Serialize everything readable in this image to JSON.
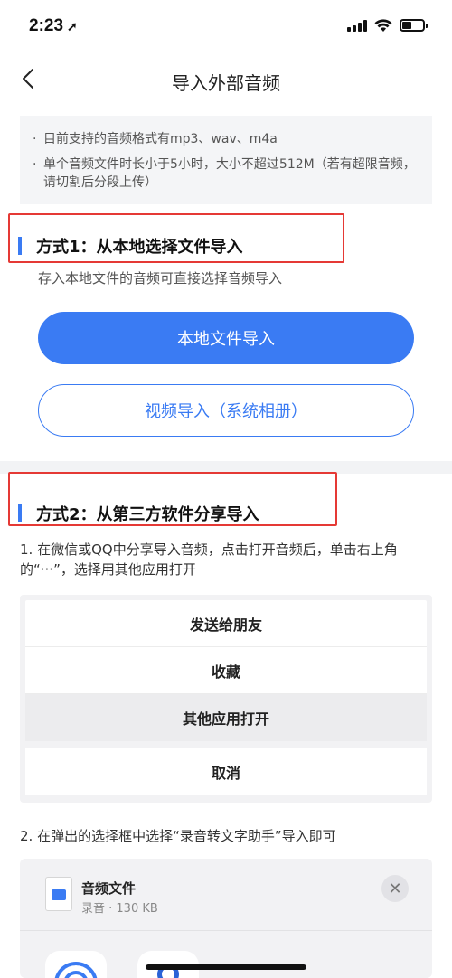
{
  "status_bar": {
    "time": "2:23",
    "location_glyph": "➚"
  },
  "nav": {
    "title": "导入外部音频",
    "back_icon": "chevron-left-icon"
  },
  "notice": {
    "bullet": "·",
    "items": [
      "目前支持的音频格式有mp3、wav、m4a",
      "单个音频文件时长小于5小时，大小不超过512M（若有超限音频，请切割后分段上传）"
    ]
  },
  "method1": {
    "heading": "方式1：从本地选择文件导入",
    "description": "存入本地文件的音频可直接选择音频导入",
    "primary_button": "本地文件导入",
    "secondary_button": "视频导入（系统相册）"
  },
  "method2": {
    "heading": "方式2：从第三方软件分享导入",
    "step1": "1. 在微信或QQ中分享导入音频，点击打开音频后，单击右上角的“···”，选择用其他应用打开",
    "sheet": {
      "items": [
        "发送给朋友",
        "收藏",
        "其他应用打开"
      ],
      "cancel": "取消"
    },
    "step2": "2. 在弹出的选择框中选择“录音转文字助手”导入即可",
    "share": {
      "file_name": "音频文件",
      "file_meta": "录音 · 130 KB",
      "close_glyph": "✕"
    }
  },
  "colors": {
    "accent": "#3a7bf3",
    "highlight_box": "#e53935"
  }
}
